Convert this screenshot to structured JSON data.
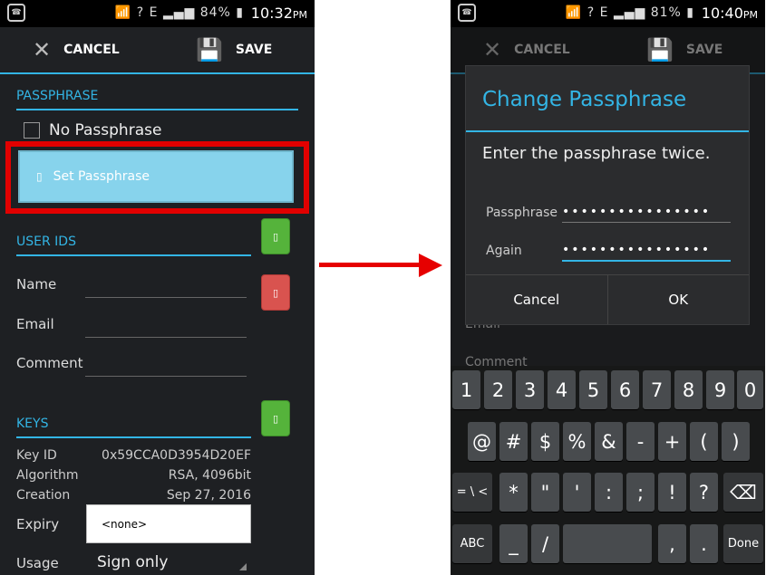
{
  "left": {
    "status": {
      "battery": "84%",
      "time": "10:32",
      "ampm": "PM",
      "network": "E"
    },
    "actionbar": {
      "cancel": "CANCEL",
      "save": "SAVE"
    },
    "passphrase": {
      "header": "PASSPHRASE",
      "no_passphrase": "No Passphrase",
      "set_button": "Set Passphrase"
    },
    "user_ids": {
      "header": "USER IDS",
      "name": "Name",
      "email": "Email",
      "comment": "Comment"
    },
    "keys": {
      "header": "KEYS",
      "rows": [
        {
          "key": "Key ID",
          "value": "0x59CCA0D3954D20EF"
        },
        {
          "key": "Algorithm",
          "value": "RSA, 4096bit"
        },
        {
          "key": "Creation",
          "value": "Sep 27, 2016"
        }
      ],
      "expiry_label": "Expiry",
      "expiry_value": "<none>",
      "usage_label": "Usage",
      "usage_value": "Sign only"
    }
  },
  "right": {
    "status": {
      "battery": "81%",
      "time": "10:40",
      "ampm": "PM",
      "network": "E"
    },
    "actionbar": {
      "cancel": "CANCEL",
      "save": "SAVE"
    },
    "background_labels": {
      "email": "Email",
      "comment": "Comment"
    },
    "dialog": {
      "title": "Change Passphrase",
      "message": "Enter the passphrase twice.",
      "passphrase_label": "Passphrase",
      "again_label": "Again",
      "passphrase_dots": "••••••••••••••••",
      "again_dots": "••••••••••••••••",
      "cancel": "Cancel",
      "ok": "OK"
    },
    "keyboard": {
      "row1": [
        "1",
        "2",
        "3",
        "4",
        "5",
        "6",
        "7",
        "8",
        "9",
        "0"
      ],
      "row2": [
        "@",
        "#",
        "$",
        "%",
        "&",
        "-",
        "+",
        "(",
        ")"
      ],
      "row3": [
        "= \\ <",
        "*",
        "\"",
        "'",
        ":",
        ";",
        "!",
        "?",
        "⌫"
      ],
      "row4": [
        "ABC",
        "_",
        "/",
        "",
        ",",
        ".",
        "Done"
      ]
    }
  },
  "colors": {
    "accent": "#33b5e5",
    "highlight": "#e10000",
    "set_button": "#87d3ec",
    "green": "#55b33b",
    "red": "#d9534f"
  }
}
